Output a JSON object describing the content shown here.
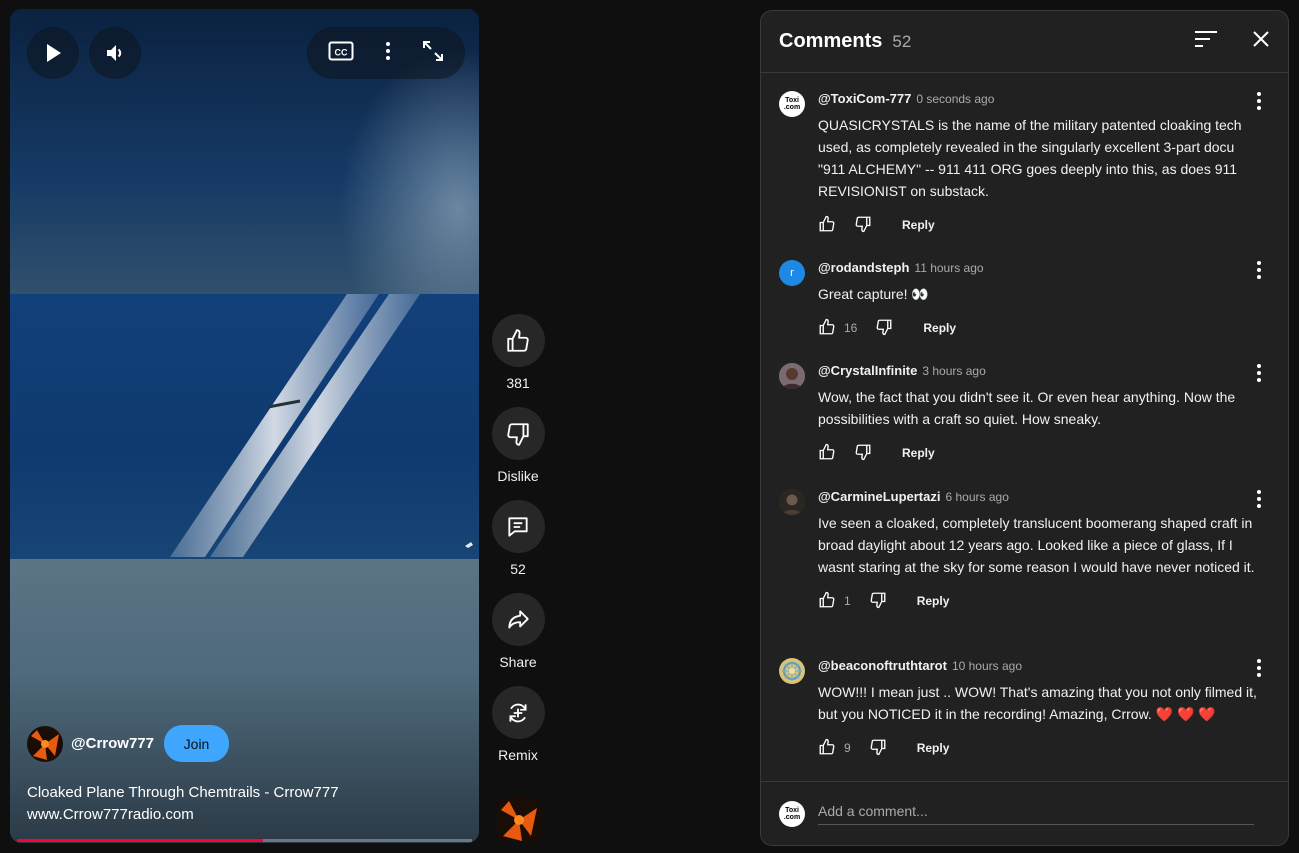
{
  "player": {
    "channel": "@Crrow777",
    "join_label": "Join",
    "title_line1": "Cloaked Plane Through Chemtrails - Crrow777",
    "title_line2": "www.Crrow777radio.com",
    "progress": 0.54
  },
  "actions": {
    "like_count": "381",
    "dislike_label": "Dislike",
    "comment_count": "52",
    "share_label": "Share",
    "remix_label": "Remix"
  },
  "comments_panel": {
    "title": "Comments",
    "count": "52",
    "add_placeholder": "Add a comment...",
    "reply_label": "Reply",
    "items": [
      {
        "user": "@ToxiCom-777",
        "time": "0 seconds ago",
        "text": "QUASICRYSTALS is the name of the military patented cloaking tech used, as completely revealed in the singularly excellent 3-part docu \"911 ALCHEMY\" -- 911 411 ORG goes deeply into this, as does 911 REVISIONIST on substack.",
        "likes": ""
      },
      {
        "user": "@rodandsteph",
        "time": "11 hours ago",
        "text": "Great capture! 👀",
        "likes": "16"
      },
      {
        "user": "@CrystalInfinite",
        "time": "3 hours ago",
        "text": "Wow, the fact that you didn't see it.  Or even hear anything.  Now the possibilities with a craft so quiet.  How sneaky.",
        "likes": ""
      },
      {
        "user": "@CarmineLupertazi",
        "time": "6 hours ago",
        "text": "Ive seen a cloaked, completely translucent boomerang shaped craft in broad daylight about 12 years ago. Looked like a piece of glass, If I wasnt staring at the sky for some reason I would have never noticed it.",
        "likes": "1"
      },
      {
        "user": "@beaconoftruthtarot",
        "time": "10 hours ago",
        "text": "WOW!!! I mean just .. WOW! That's amazing that you not only filmed it, but you NOTICED it in the recording! Amazing, Crrow. ❤️ ❤️ ❤️",
        "likes": "9"
      }
    ]
  },
  "avatars": {
    "toxi_line1": "Toxi",
    "toxi_line2": ".com",
    "rod_initial": "r"
  },
  "colors": {
    "accent": "#3ea6ff",
    "progress": "#ff0033",
    "panel_bg": "#212121"
  }
}
